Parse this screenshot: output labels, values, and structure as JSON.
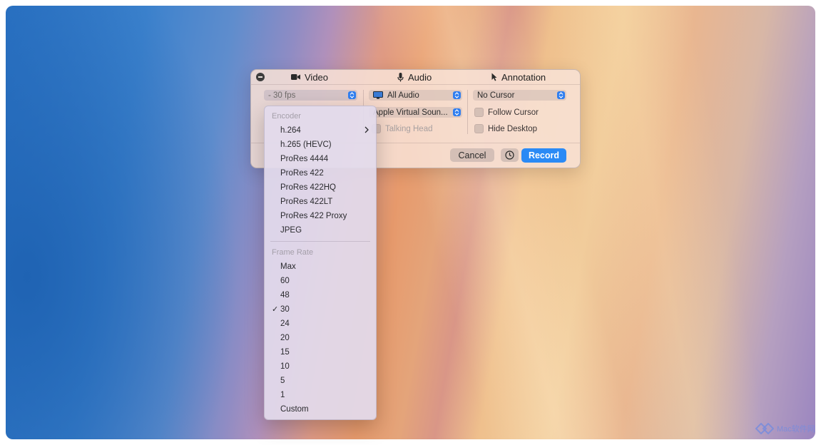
{
  "panel": {
    "tabs": {
      "video": "Video",
      "audio": "Audio",
      "annotation": "Annotation"
    },
    "video": {
      "framerate_popup": "- 30 fps"
    },
    "audio": {
      "source_popup": "All Audio",
      "device_popup": "Apple Virtual Soun...",
      "talking_head": "Talking Head"
    },
    "annotation": {
      "cursor_popup": "No Cursor",
      "follow_cursor": "Follow Cursor",
      "hide_desktop": "Hide Desktop"
    },
    "footer": {
      "cancel_label": "Cancel",
      "record_label": "Record"
    }
  },
  "menu": {
    "encoder_header": "Encoder",
    "encoders": [
      "h.264",
      "h.265 (HEVC)",
      "ProRes 4444",
      "ProRes 422",
      "ProRes 422HQ",
      "ProRes 422LT",
      "ProRes 422 Proxy",
      "JPEG"
    ],
    "framerate_header": "Frame Rate",
    "framerates": [
      "Max",
      "60",
      "48",
      "30",
      "24",
      "20",
      "15",
      "10",
      "5",
      "1",
      "Custom"
    ],
    "selected_framerate": "30",
    "checkmark": "✓"
  },
  "watermark": {
    "text": "Mac软件网"
  },
  "colors": {
    "accent": "#2a8af5",
    "stepper": "#2f7ef0"
  }
}
